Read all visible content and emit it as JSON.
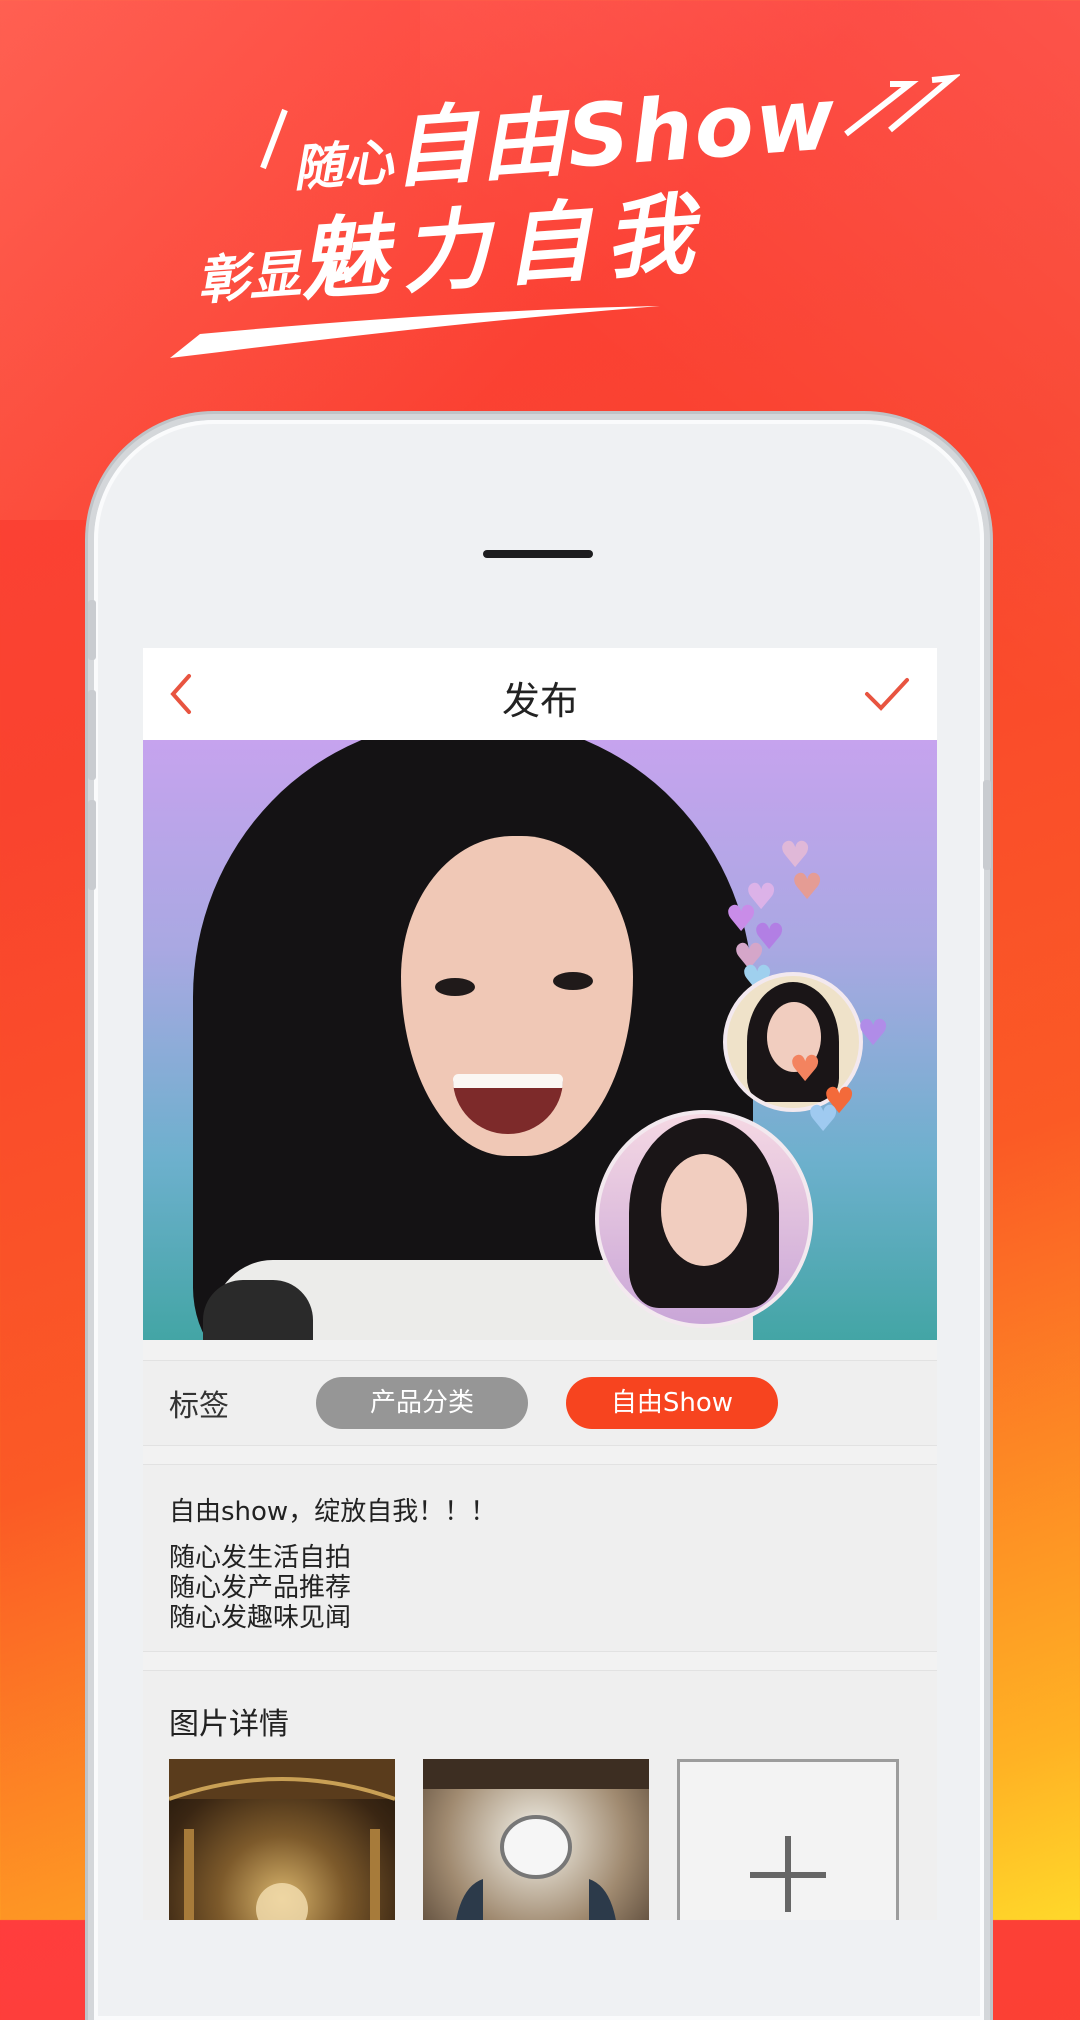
{
  "headline": {
    "line1_small": "随心",
    "line1_big": "自由Show",
    "line2_small": "彰显",
    "line2_big": "魅力自我"
  },
  "nav": {
    "title": "发布"
  },
  "tags": {
    "label": "标签",
    "options": [
      "产品分类",
      "自由Show"
    ],
    "selected": "自由Show"
  },
  "description": {
    "first_line": "自由show，绽放自我！！！",
    "lines": [
      "随心发生活自拍",
      "随心发产品推荐",
      "随心发趣味见闻"
    ]
  },
  "details": {
    "label": "图片详情",
    "add_symbol": "+"
  },
  "colors": {
    "accent": "#f7441f",
    "tag_gray": "#969696",
    "nav_icon": "#e85440"
  }
}
